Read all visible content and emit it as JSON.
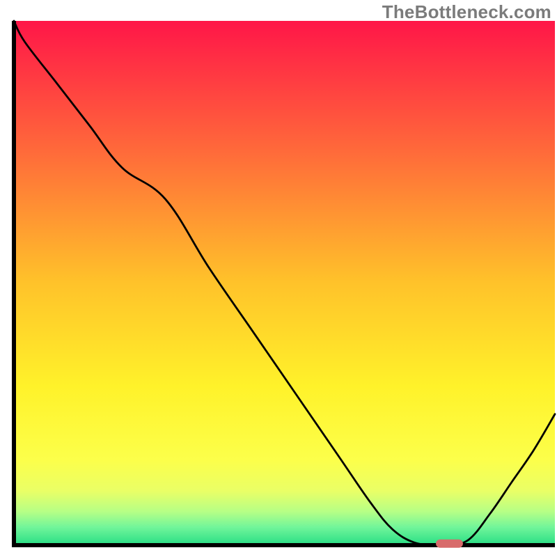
{
  "watermark": "TheBottleneck.com",
  "chart_data": {
    "type": "line",
    "title": "",
    "xlabel": "",
    "ylabel": "",
    "xlim": [
      0,
      100
    ],
    "ylim": [
      0,
      100
    ],
    "grid": false,
    "legend": null,
    "x": [
      0,
      2,
      8,
      14,
      20,
      28,
      36,
      44,
      52,
      60,
      66,
      70,
      74,
      78,
      80,
      84,
      88,
      92,
      96,
      100
    ],
    "y": [
      100,
      96,
      88,
      80,
      72,
      66,
      53,
      41,
      29,
      17,
      8,
      3,
      0.5,
      0,
      0,
      1,
      6,
      12,
      18,
      25
    ],
    "marker": {
      "shape": "rounded-rect",
      "x_range": [
        78,
        83
      ],
      "y": 0.3,
      "color": "#d86b6b"
    },
    "background_gradient": {
      "type": "vertical",
      "stops": [
        {
          "pos": 0.0,
          "color": "#ff1648"
        },
        {
          "pos": 0.25,
          "color": "#ff6a3a"
        },
        {
          "pos": 0.5,
          "color": "#ffc22a"
        },
        {
          "pos": 0.7,
          "color": "#fff22a"
        },
        {
          "pos": 0.84,
          "color": "#fcff4a"
        },
        {
          "pos": 0.9,
          "color": "#eaff66"
        },
        {
          "pos": 0.94,
          "color": "#b6ff86"
        },
        {
          "pos": 0.97,
          "color": "#70f59a"
        },
        {
          "pos": 1.0,
          "color": "#30e087"
        }
      ]
    },
    "line_style": {
      "color": "#000000",
      "width": 2.8
    },
    "axes": {
      "left": {
        "color": "#000000",
        "width": 6
      },
      "bottom": {
        "color": "#000000",
        "width": 6
      }
    }
  }
}
